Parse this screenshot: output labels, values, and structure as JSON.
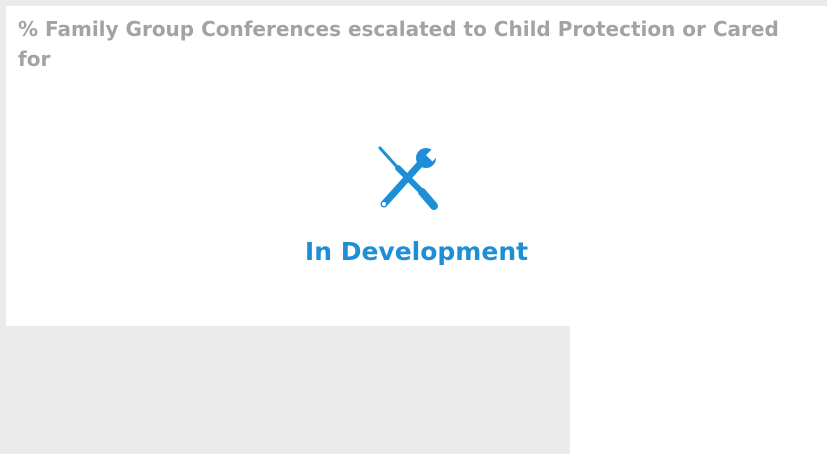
{
  "card": {
    "title": "% Family Group Conferences escalated to Child Protection or Cared for",
    "status_label": "In Development",
    "icon": "tools-icon"
  },
  "colors": {
    "title_text": "#a3a3a3",
    "accent": "#1e8fd6",
    "background_gray": "#ebebeb"
  }
}
